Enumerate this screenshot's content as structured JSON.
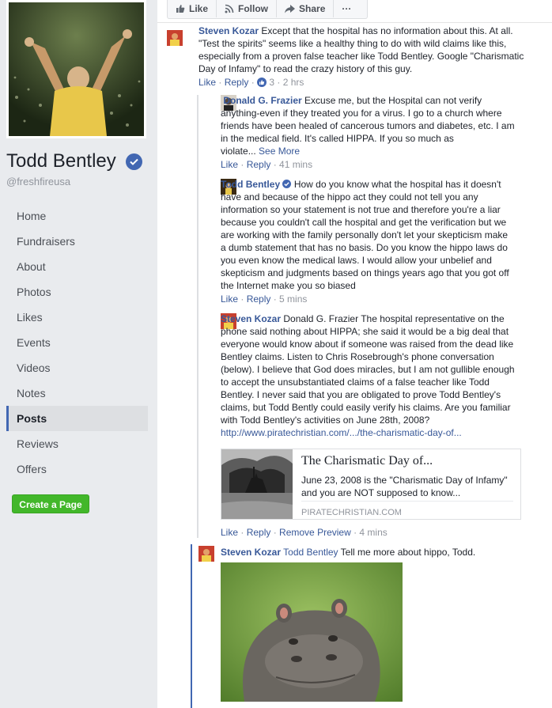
{
  "sidebar": {
    "page_name": "Todd Bentley",
    "handle": "@freshfireusa",
    "nav": [
      "Home",
      "Fundraisers",
      "About",
      "Photos",
      "Likes",
      "Events",
      "Videos",
      "Notes",
      "Posts",
      "Reviews",
      "Offers"
    ],
    "active": "Posts",
    "create_page_label": "Create a Page"
  },
  "actions": {
    "like": "Like",
    "follow": "Follow",
    "share": "Share",
    "more": "···"
  },
  "colors": {
    "link": "#385898",
    "brand": "#4267b2",
    "green": "#42b72a",
    "meta": "#90949c"
  },
  "comments": [
    {
      "author": "Steven Kozar",
      "text_lines": [
        "Except that the hospital has no information about this. At all.",
        "\"Test the spirits\" seems like a healthy thing to do with wild claims like this,",
        "especially from a proven false teacher like Todd Bentley. Google \"Charismatic",
        "Day of Infamy\" to read the crazy history of this guy."
      ],
      "like": "Like",
      "reply": "Reply",
      "reactions": "3",
      "time": "2 hrs"
    },
    {
      "author": "Donald G. Frazier",
      "text_lines": [
        "Excuse me, but the Hospital can not verify",
        "anything-even if they treated you for a virus. I go to a church where",
        "friends have been healed of cancerous tumors and diabetes, etc. I am",
        "in the medical field. It's called HIPPA. If you so much as",
        "violate..."
      ],
      "see_more": "See More",
      "like": "Like",
      "reply": "Reply",
      "time": "41 mins"
    },
    {
      "author": "Todd Bentley",
      "text_lines": [
        "How do you know what the hospital has it doesn't",
        "have and because of the hippo act they could not tell you any",
        "information so your statement is not true and therefore you're a liar",
        "because you couldn't call the hospital and get the verification but we",
        "are working with the family personally don't let your skepticism make",
        "a dumb statement that has no basis. Do you know the hippo laws do",
        "you even know the medical laws. I would allow your unbelief and",
        "skepticism and judgments based on things years ago that you got off",
        "the Internet make you so biased"
      ],
      "like": "Like",
      "reply": "Reply",
      "time": "5 mins"
    },
    {
      "author": "Steven Kozar",
      "mention": "Donald G. Frazier",
      "text_lines": [
        "The hospital representative on the",
        "phone said nothing about HIPPA; she said it would be a big deal that",
        "everyone would know about if someone was raised from the dead like",
        "Bentley claims. Listen to Chris Rosebrough's phone conversation",
        "(below). I believe that God does miracles, but I am not gullible enough",
        "to accept the unsubstantiated claims of a false teacher like Todd",
        "Bentley. I never said that you are obligated to prove Todd Bentley's",
        "claims, but Todd Bently could easily verify his claims. Are you familiar",
        "with Todd Bentley's activities on June 28th, 2008?"
      ],
      "url": "http://www.piratechristian.com/.../the-charismatic-day-of...",
      "preview": {
        "title": "The Charismatic Day of...",
        "desc": "June 23, 2008 is the \"Charismatic Day of Infamy\" and you are NOT supposed to know...",
        "domain": "PIRATECHRISTIAN.COM"
      },
      "like": "Like",
      "reply": "Reply",
      "remove_preview": "Remove Preview",
      "time": "4 mins"
    },
    {
      "author": "Steven Kozar",
      "mention": "Todd Bentley",
      "text": "Tell me more about hippo, Todd."
    }
  ]
}
